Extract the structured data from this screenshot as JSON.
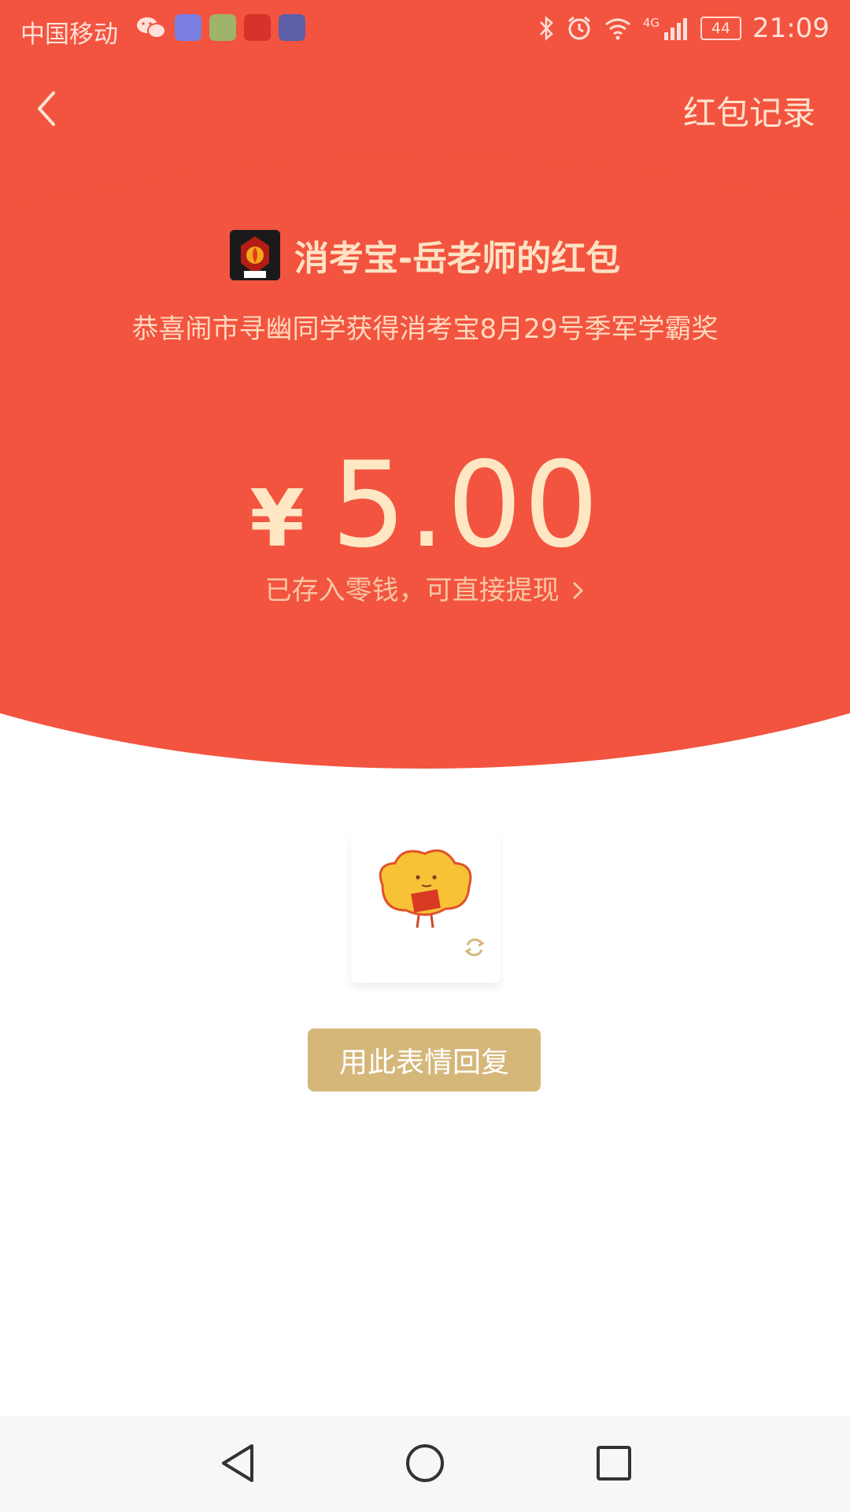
{
  "status_bar": {
    "carrier": "中国移动",
    "network": "4G",
    "battery": "44",
    "time": "21:09"
  },
  "header": {
    "record_label": "红包记录"
  },
  "sender": {
    "title": "消考宝-岳老师的红包",
    "message": "恭喜闹市寻幽同学获得消考宝8月29号季军学霸奖"
  },
  "amount": {
    "currency": "¥",
    "value": "5.00",
    "stored_text": "已存入零钱，可直接提现"
  },
  "reply": {
    "button_label": "用此表情回复"
  },
  "colors": {
    "red_bg": "#f2543f",
    "gold_text": "#ffe7c4",
    "reply_button": "#d6b77a"
  }
}
